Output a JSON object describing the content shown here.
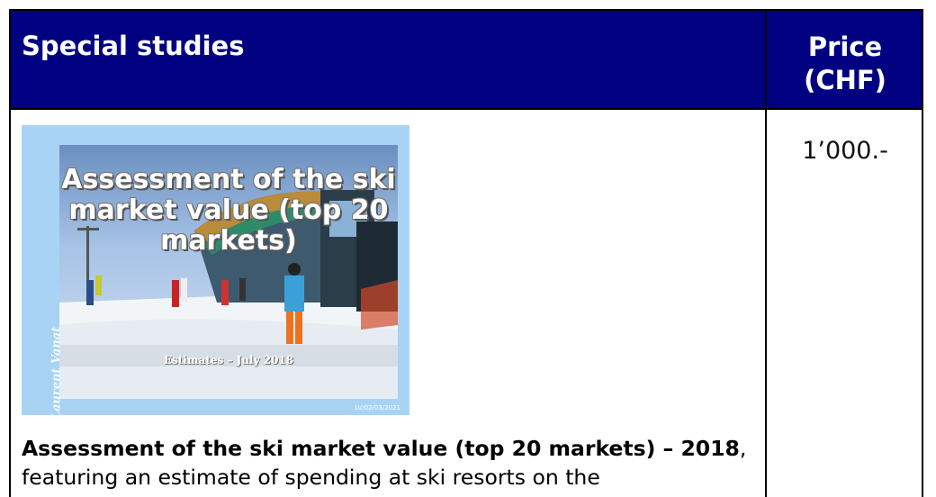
{
  "header": {
    "title": "Special studies",
    "price": "Price (CHF)"
  },
  "study": {
    "price_value": "1’000.-",
    "cover": {
      "title": "Assessment of the ski market value (top 20 markets)",
      "subtitle": "Estimates – July 2018",
      "author": "Laurent Vanat",
      "code": "LV/02/03/2021"
    },
    "description": {
      "bold": "Assessment of the ski market value (top 20 markets) – 2018",
      "rest": ", featuring an estimate of spending at ski resorts on the"
    }
  },
  "colors": {
    "header_bg": "#000080",
    "cover_bg": "#a8d3f5"
  }
}
